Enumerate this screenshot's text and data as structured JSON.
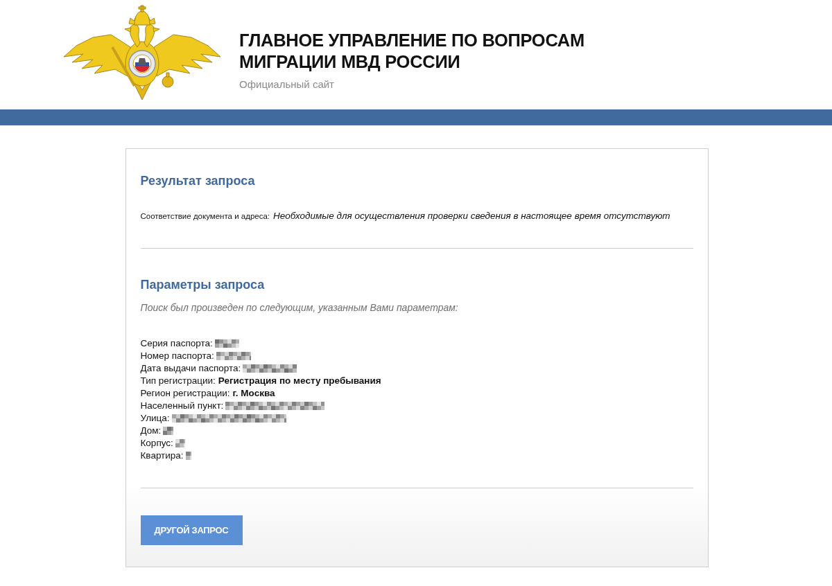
{
  "header": {
    "title_lines": [
      "ГЛАВНОЕ УПРАВЛЕНИЕ ПО ВОПРОСАМ",
      "МИГРАЦИИ МВД РОССИИ"
    ],
    "subtitle": "Официальный сайт"
  },
  "result": {
    "heading": "Результат запроса",
    "label": "Соответствие документа и адреса:",
    "value": "Необходимые для осуществления проверки сведения в настоящее время отсутствуют"
  },
  "parameters": {
    "heading": "Параметры запроса",
    "intro": "Поиск был произведен по следующим, указанным Вами параметрам:",
    "items": [
      {
        "label": "Серия паспорта:",
        "redacted": true
      },
      {
        "label": "Номер паспорта:",
        "redacted": true
      },
      {
        "label": "Дата выдачи паспорта:",
        "redacted": true
      },
      {
        "label": "Тип регистрации:",
        "value": "Регистрация по месту пребывания",
        "redacted": false
      },
      {
        "label": "Регион регистрации:",
        "value": "г. Москва",
        "redacted": false
      },
      {
        "label": "Населенный пункт:",
        "redacted": true
      },
      {
        "label": "Улица:",
        "redacted": true
      },
      {
        "label": "Дом:",
        "redacted": true
      },
      {
        "label": "Корпус:",
        "redacted": true
      },
      {
        "label": "Квартира:",
        "redacted": true
      }
    ]
  },
  "button": {
    "label": "ДРУГОЙ ЗАПРОС"
  }
}
